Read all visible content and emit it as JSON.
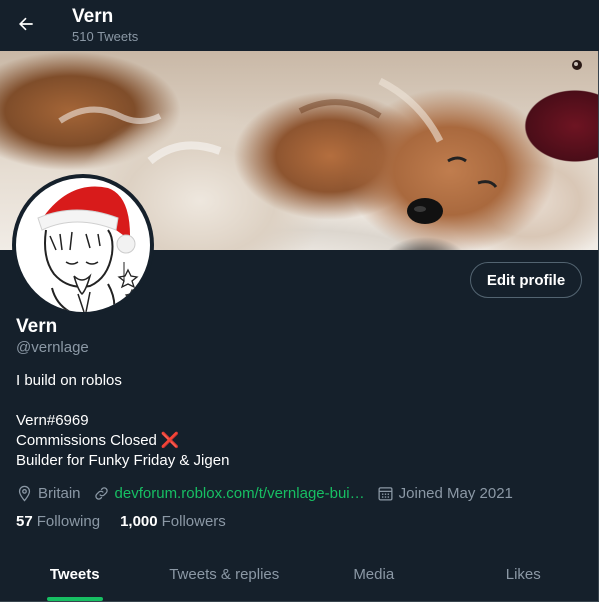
{
  "header": {
    "title": "Vern",
    "subtitle": "510 Tweets"
  },
  "profile": {
    "edit_label": "Edit profile",
    "name": "Vern",
    "handle": "@vernlage",
    "bio_lines": [
      "I build on roblos",
      "",
      "Vern#6969",
      "Commissions Closed",
      "Builder for Funky Friday & Jigen"
    ],
    "bio_mark": "❌"
  },
  "meta": {
    "location": "Britain",
    "website": "devforum.roblox.com/t/vernlage-bui…",
    "joined": "Joined May 2021"
  },
  "stats": {
    "following_count": "57",
    "following_label": "Following",
    "followers_count": "1,000",
    "followers_label": "Followers"
  },
  "tabs": [
    {
      "label": "Tweets",
      "active": true
    },
    {
      "label": "Tweets & replies",
      "active": false
    },
    {
      "label": "Media",
      "active": false
    },
    {
      "label": "Likes",
      "active": false
    }
  ],
  "colors": {
    "background": "#15202b",
    "accent": "#17bf63",
    "secondary_text": "#8b98a5",
    "link": "#17bf63"
  }
}
